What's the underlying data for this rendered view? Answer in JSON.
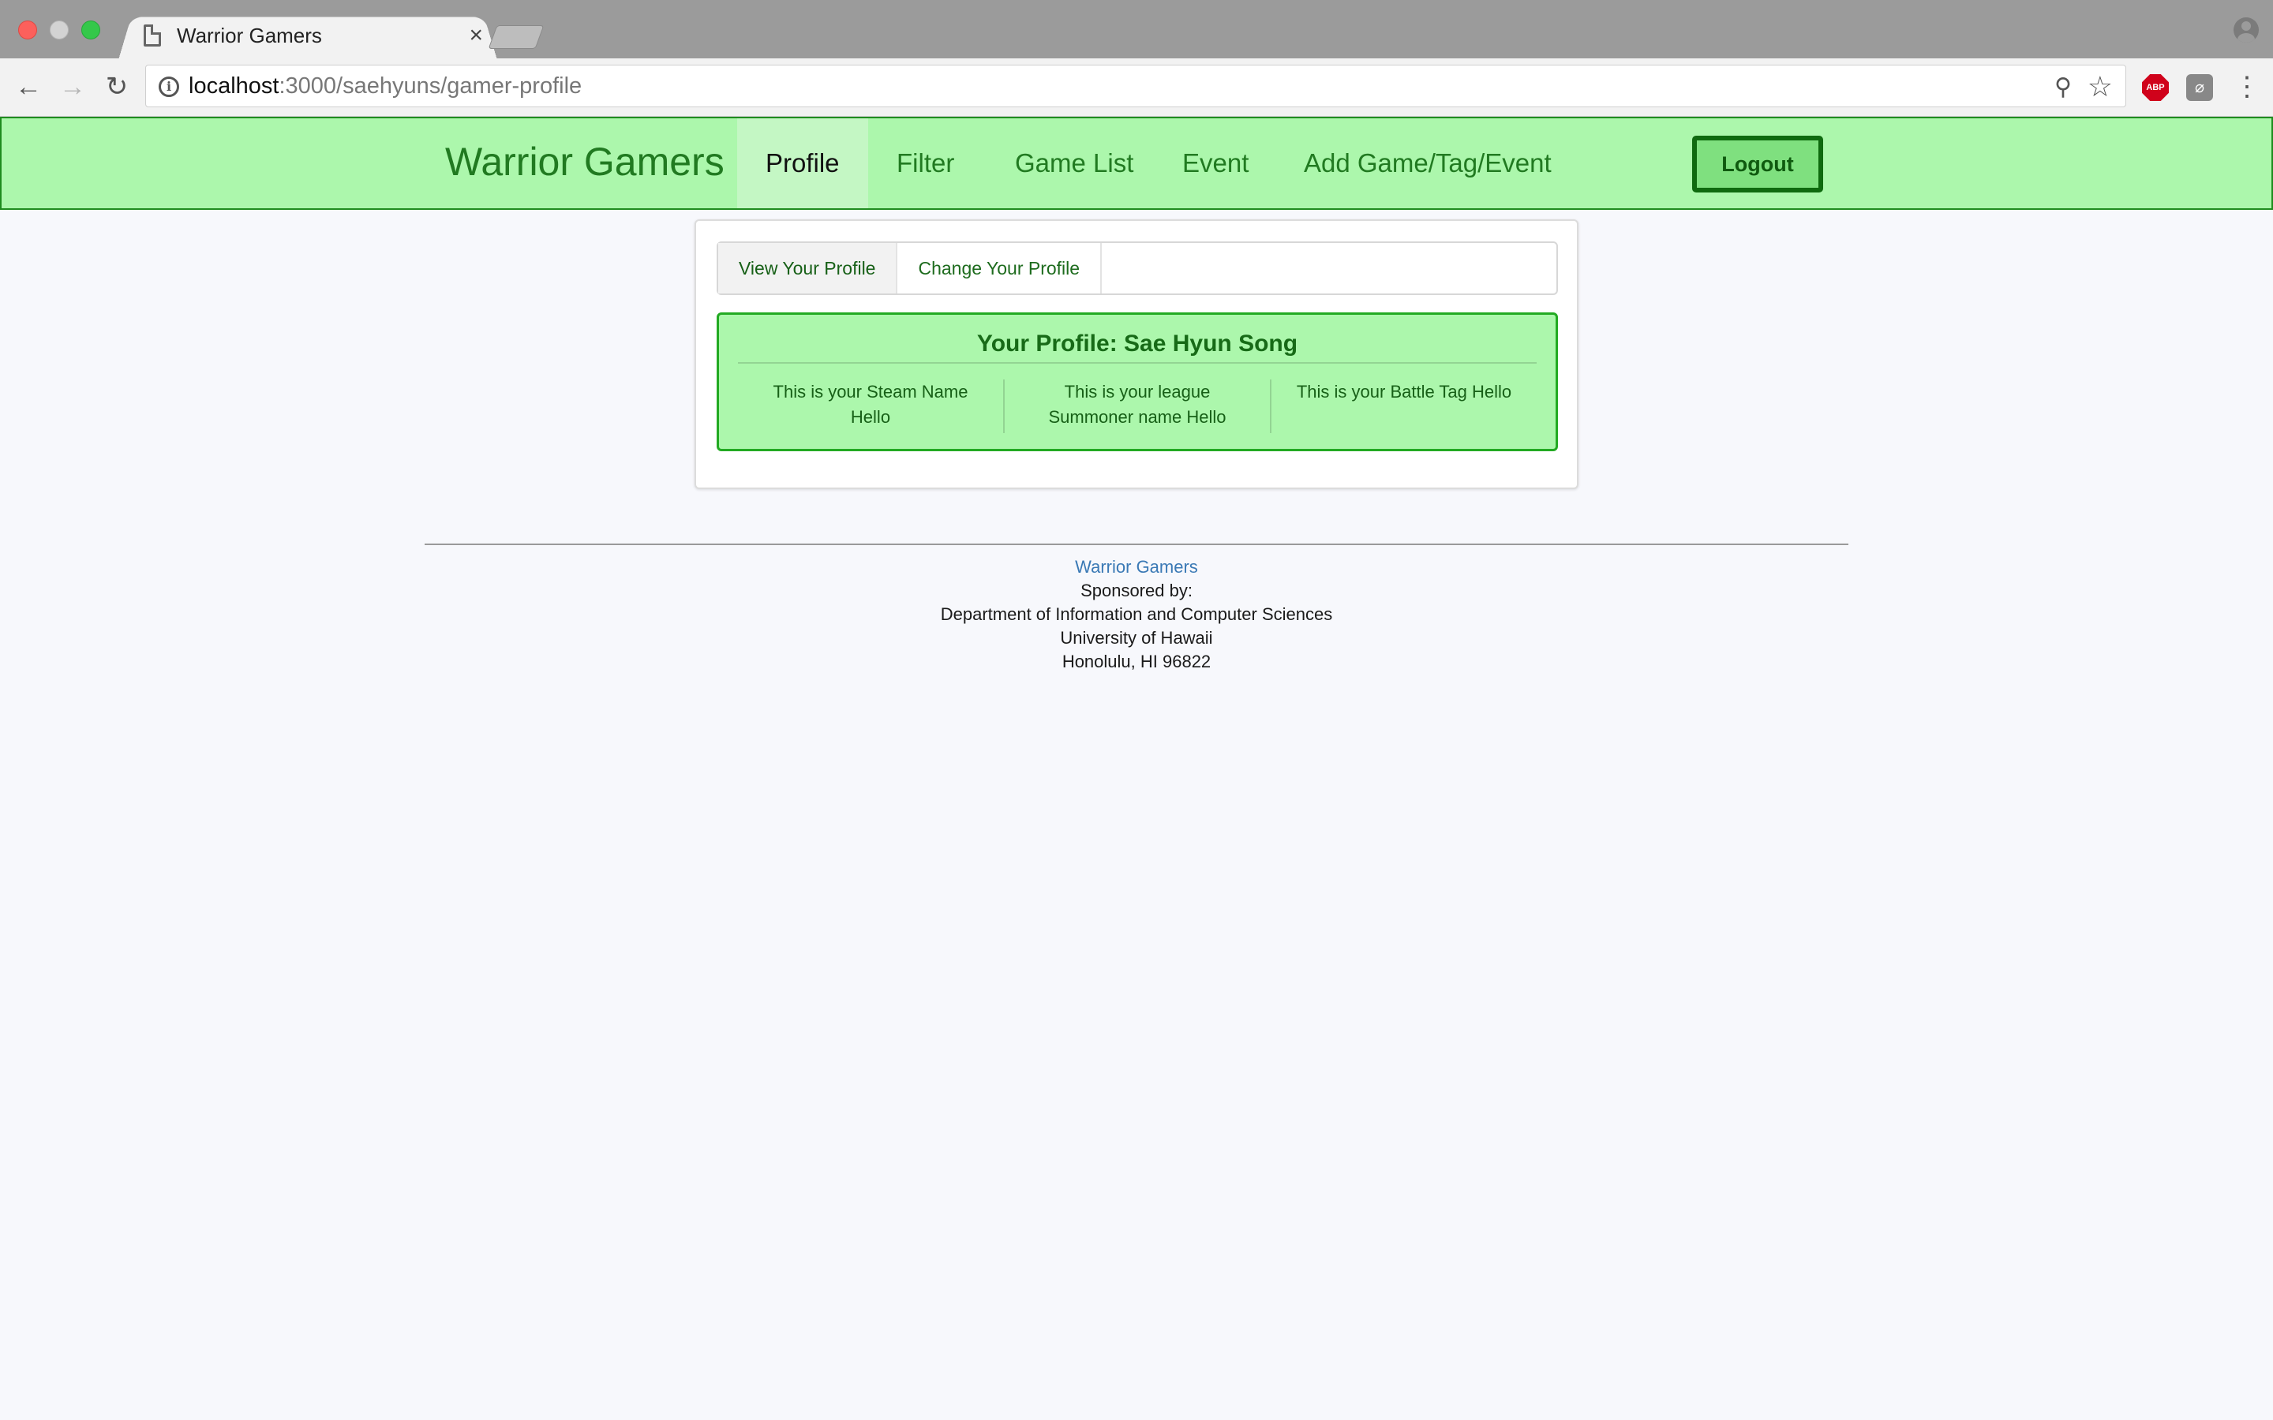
{
  "browser": {
    "tab_title": "Warrior Gamers",
    "tab_close": "×",
    "url_host": "localhost",
    "url_rest": ":3000/saehyuns/gamer-profile",
    "extension_label": "ABP"
  },
  "navbar": {
    "brand": "Warrior Gamers",
    "items": [
      {
        "label": "Profile",
        "active": true
      },
      {
        "label": "Filter"
      },
      {
        "label": "Game List"
      },
      {
        "label": "Event"
      },
      {
        "label": "Add Game/Tag/Event"
      }
    ],
    "logout_label": "Logout"
  },
  "profile_menu": {
    "view_label": "View Your Profile",
    "change_label": "Change Your Profile"
  },
  "profile": {
    "title": "Your Profile: Sae Hyun Song",
    "steam": "This is your Steam Name Hello",
    "league": "This is your league Summoner name Hello",
    "battletag": "This is your Battle Tag Hello"
  },
  "footer": {
    "site_name": "Warrior Gamers",
    "sponsored": "Sponsored by:",
    "department": "Department of Information and Computer Sciences",
    "university": "University of Hawaii",
    "address": "Honolulu, HI 96822"
  },
  "colors": {
    "navbar_bg": "#acf7ac",
    "brand_green": "#217a21",
    "footer_link": "#3a79b5"
  }
}
